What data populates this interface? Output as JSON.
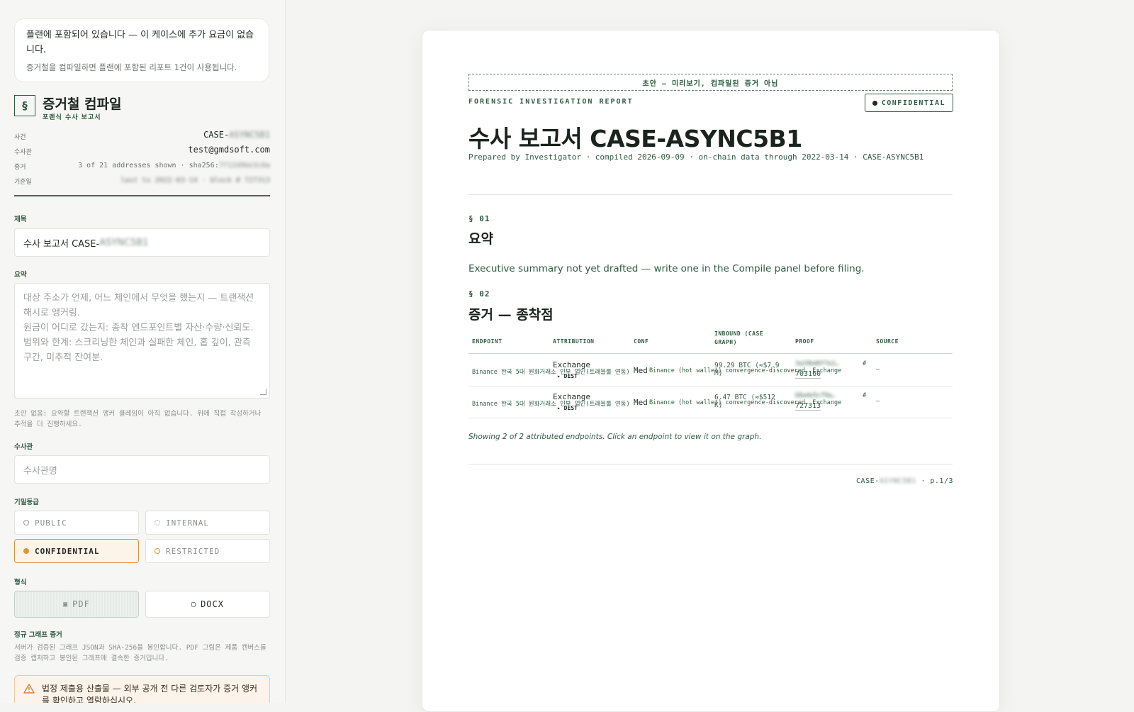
{
  "plan": {
    "line1": "플랜에 포함되어 있습니다 — 이 케이스에 추가 요금이 없습니다.",
    "line2": "증거철을 컴파일하면 플랜에 포함된 리포트 1건이 사용됩니다."
  },
  "compile": {
    "section_glyph": "§",
    "title": "증거철 컴파일",
    "subtitle": "포렌식 수사 보고서"
  },
  "meta": {
    "case_label": "사건",
    "case_prefix": "CASE-",
    "case_blurred": "ASYNC5B1",
    "investigator_label": "수사관",
    "investigator_value": "test@gmdsoft.com",
    "evidence_label": "증거",
    "evidence_value": "3 of 21 addresses shown · sha256:",
    "evidence_hash": "7f12d9be3c0a",
    "basis_label": "기준일",
    "basis_value": "last tx 2022-03-14 · block # 727313"
  },
  "form": {
    "title_label": "제목",
    "title_value_prefix": "수사 보고서 CASE-",
    "title_value_blurred": "ASYNC5B1",
    "summary_label": "요약",
    "summary_placeholder_lines": [
      "대상 주소가 언제, 어느 체인에서 무엇을 했는지 — 트랜잭션 해시로 앵커링.",
      "원금이 어디로 갔는지: 종착 엔드포인트별 자산·수량·신뢰도.",
      "범위와 한계: 스크리닝한 체인과 실패한 체인, 홉 깊이, 관측 구간, 미추적 잔여분."
    ],
    "summary_hint": "초안 없음: 요약할 트랜잭션 앵커 클레임이 아직 없습니다. 위에 직접 작성하거나 추적을 더 진행하세요.",
    "investigator_label": "수사관",
    "investigator_placeholder": "수사관명",
    "classification_label": "기밀등급",
    "classifications": [
      "PUBLIC",
      "INTERNAL",
      "CONFIDENTIAL",
      "RESTRICTED"
    ],
    "selected_classification": "CONFIDENTIAL",
    "format_label": "형식",
    "format_pdf": "PDF",
    "format_docx": "DOCX",
    "format_pdf_glyph": "▣",
    "format_docx_glyph": "▢",
    "graph_label": "정규 그래프 증거",
    "graph_hint": "서버가 검증된 그래프 JSON과 SHA-256을 봉인합니다. PDF 그림은 제품 캔버스를 검증 캡처하고 봉인된 그래프에 결속한 증거입니다.",
    "warning": "법정 제출용 산출물 — 외부 공개 전 다른 검토자가 증거 앵커를 확인하고 열람하십시오."
  },
  "document": {
    "draft_banner": "초안 — 미리보기, 컴파일된 증거 아님",
    "report_label": "FORENSIC INVESTIGATION REPORT",
    "confidential_badge": "CONFIDENTIAL",
    "title": "수사 보고서 CASE-ASYNC5B1",
    "prepared": "Prepared by Investigator  ·  compiled 2026-09-09 · on-chain data through 2022-03-14  ·  CASE-ASYNC5B1",
    "sections": [
      {
        "num": "§ 01",
        "title": "요약"
      },
      {
        "num": "§ 02",
        "title": "증거 — 종착점"
      }
    ],
    "summary_text": "Executive summary not yet drafted — write one in the Compile panel before filing.",
    "table": {
      "headers": [
        "ENDPOINT",
        "ATTRIBUTION",
        "CONF",
        "INBOUND (CASE GRAPH)",
        "PROOF",
        "SOURCE"
      ],
      "rows": [
        {
          "endpoint": "Binance 한국 5대 원화거래소 인부 업인(트래블룰 연동)",
          "attr_type": "Exchange",
          "attr_dest": "▸ DEST",
          "conf": "Med",
          "attr_detail": "Binance (hot wallet) convergence-discovered, Exchange",
          "inbound": "99.29 BTC (≈$7.9 M)",
          "proof_blur": "3a19bd0f7e2…",
          "proof_hash": "#",
          "proof_block": "703160",
          "source": "—"
        },
        {
          "endpoint": "Binance 한국 5대 원화거래소 인부 업인(트래블룰 연동)",
          "attr_type": "Exchange",
          "attr_dest": "▸ DEST",
          "conf": "Med",
          "attr_detail": "Binance (hot wallet) convergence-discovered, Exchange",
          "inbound": "6.47 BTC (≈$512 K)",
          "proof_blur": "b8a4e5cf9a…",
          "proof_hash": "#",
          "proof_block": "727313",
          "source": "—"
        }
      ],
      "note": "Showing 2 of 2 attributed endpoints. Click an endpoint to view it on the graph."
    },
    "footer_prefix": "CASE-",
    "footer_blurred": "ASYNC5B1",
    "footer_page": "· p.1/3"
  },
  "colors": {
    "accent_green": "#2e5b3f",
    "selected_orange": "#e0923c"
  }
}
